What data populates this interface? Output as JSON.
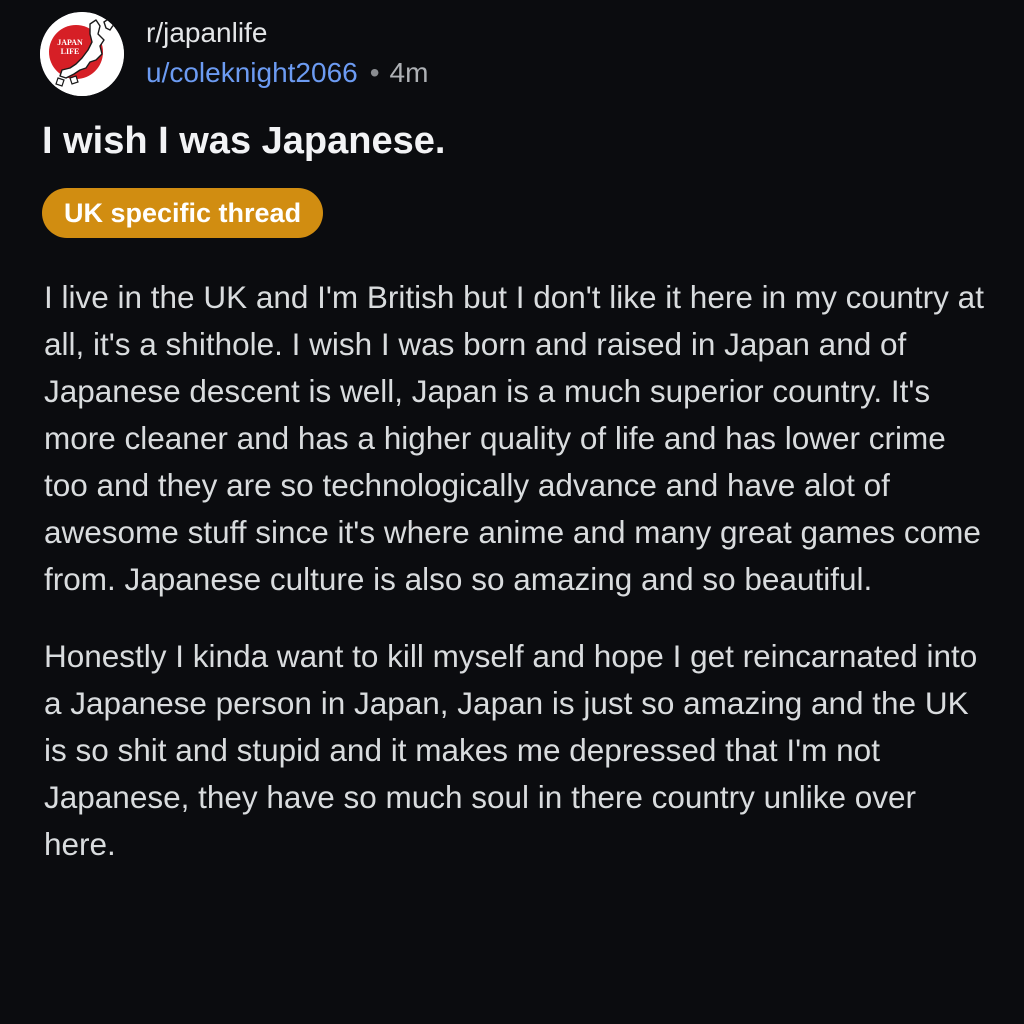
{
  "post": {
    "community": "r/japanlife",
    "author": "u/coleknight2066",
    "separator": "•",
    "age": "4m",
    "title": "I wish I was Japanese.",
    "flair": "UK specific thread",
    "paragraphs": [
      "I live in the UK and I'm British but I don't like it here in my country at all, it's a shithole. I wish I was born and raised in Japan and of Japanese descent is well, Japan is a much superior country. It's more cleaner and has a higher quality of life and has lower crime too and they are so technologically advance and have alot of awesome stuff since it's where anime and many great games come from. Japanese culture is also so amazing and so beautiful.",
      "Honestly I kinda want to kill myself and hope I get reincarnated into a Japanese person in Japan, Japan is just so amazing and the UK is so shit and stupid and it makes me depressed that I'm not Japanese, they have so much soul in there country unlike over here."
    ]
  },
  "avatar": {
    "icon": "japanlife-community-icon",
    "logo_text": [
      "JAPAN",
      "LIFE"
    ]
  },
  "colors": {
    "background": "#0b0c0f",
    "username": "#6c9bf2",
    "flair_bg": "#d18d11",
    "logo_red": "#d61f26"
  }
}
